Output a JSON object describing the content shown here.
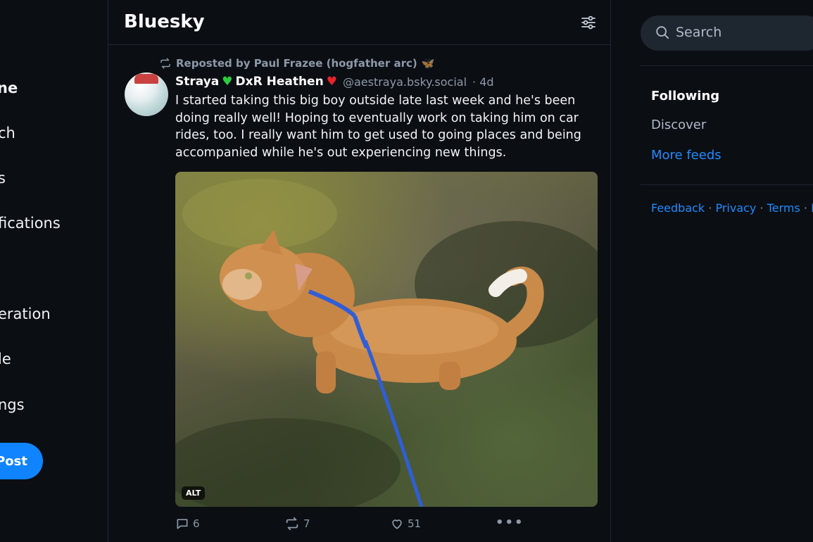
{
  "nav": {
    "items": [
      {
        "label": "Home",
        "visible": "ne"
      },
      {
        "label": "Search",
        "visible": "ch"
      },
      {
        "label": "Feeds",
        "visible": "s"
      },
      {
        "label": "Notifications",
        "visible": "fications"
      },
      {
        "label": "Moderation",
        "visible": "eration"
      },
      {
        "label": "Profile",
        "visible": "le"
      },
      {
        "label": "Settings",
        "visible": "ngs"
      }
    ],
    "post_label": "Post"
  },
  "header": {
    "title": "Bluesky"
  },
  "post": {
    "repost_text": "Reposted by Paul Frazee (hogfather arc)",
    "author_name_1": "Straya",
    "author_name_2": "DxR Heathen",
    "handle": "@aestraya.bsky.social",
    "age": "· 4d",
    "text": "I started taking this big boy outside late last week and he's been doing really well! Hoping to eventually work on taking him on car rides, too. I really want him to get used to going places and being accompanied while he's out experiencing new things.",
    "alt_badge": "ALT",
    "replies": "6",
    "reposts": "7",
    "likes": "51"
  },
  "right": {
    "search_placeholder": "Search",
    "feeds": [
      "Following",
      "Discover"
    ],
    "more_feeds": "More feeds",
    "footer": [
      "Feedback",
      "Privacy",
      "Terms",
      "H"
    ]
  },
  "colors": {
    "accent": "#1083fe",
    "link": "#208bfe",
    "background": "#0b0e13",
    "muted": "#8c99a8"
  }
}
